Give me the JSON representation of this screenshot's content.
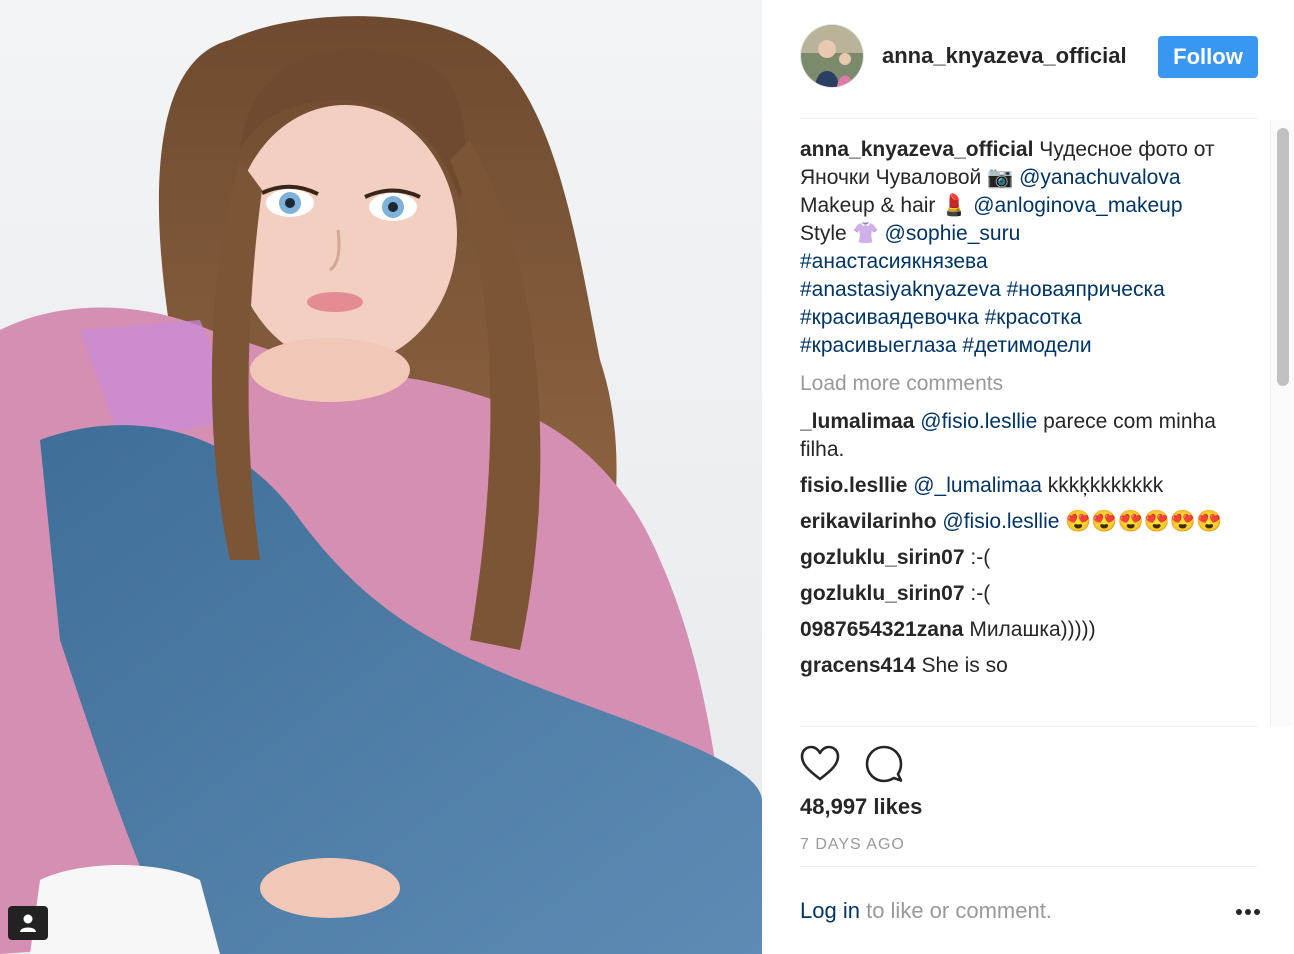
{
  "header": {
    "username": "anna_knyazeva_official",
    "follow_label": "Follow"
  },
  "caption": {
    "user": "anna_knyazeva_official",
    "line1": "Чудесное фото от",
    "line2_text": "Яночки Чуваловой 📷",
    "line2_mention": "@yanachuvalova",
    "line3_text": "Makeup & hair 💄",
    "line3_mention": "@anloginova_makeup",
    "line4_text": "Style 👚",
    "line4_mention": "@sophie_suru",
    "hashtags": [
      "#анастасиякнязева",
      "#anastasiyaknyazeva #новаяприческа",
      "#красиваядевочка #красотка",
      "#красивыеглаза #детимодели"
    ]
  },
  "load_more_label": "Load more comments",
  "comments": [
    {
      "user": "_lumalimaa",
      "mention": "@fisio.lesllie",
      "text": "parece com minha filha."
    },
    {
      "user": "fisio.lesllie",
      "mention": "@_lumalimaa",
      "text": "kkkķkkkkkkk"
    },
    {
      "user": "erikavilarinho",
      "mention": "@fisio.lesllie",
      "text": "😍😍😍😍😍😍"
    },
    {
      "user": "gozluklu_sirin07",
      "mention": "",
      "text": ":-("
    },
    {
      "user": "gozluklu_sirin07",
      "mention": "",
      "text": ":-("
    },
    {
      "user": "0987654321zana",
      "mention": "",
      "text": "Милашка)))))"
    },
    {
      "user": "gracens414",
      "mention": "",
      "text": "She is so"
    }
  ],
  "likes": "48,997 likes",
  "time_ago": "7 DAYS AGO",
  "login": {
    "link": "Log in",
    "rest": "to like or comment."
  },
  "icons": {
    "like": "heart-icon",
    "comment": "speech-bubble-icon",
    "more": "more-dots-icon",
    "tag": "user-tag-icon"
  },
  "colors": {
    "follow_bg": "#3897f0",
    "link": "#003569",
    "muted": "#999999",
    "text": "#262626"
  }
}
